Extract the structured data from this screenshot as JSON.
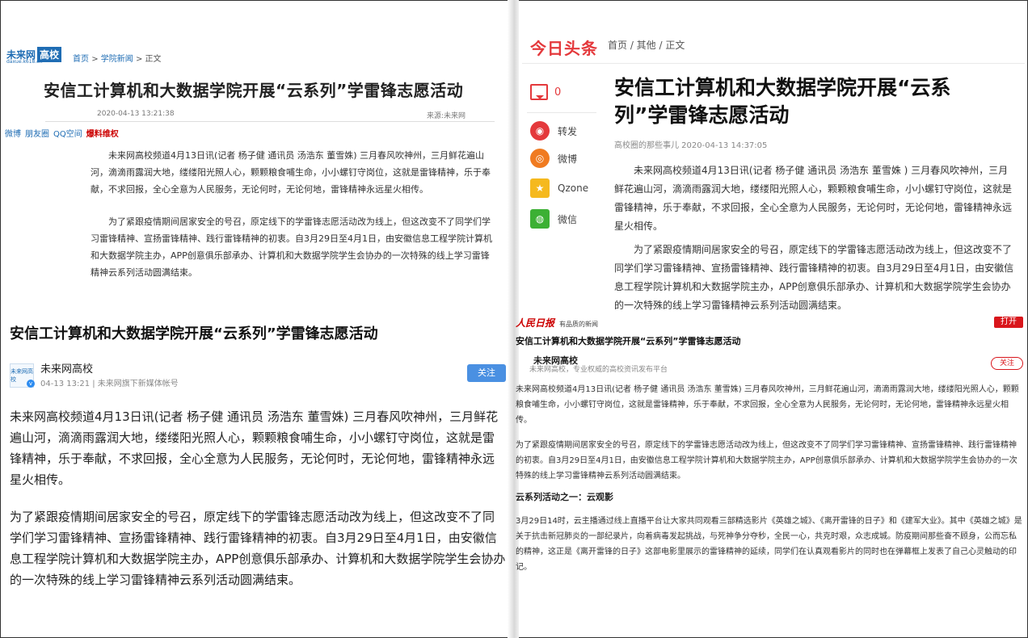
{
  "weilai": {
    "logo": "未来网",
    "logo_badge": "高校",
    "logo_sub": "daxue.k618.cn",
    "breadcrumb": [
      "首页",
      "学院新闻",
      "正文"
    ],
    "title": "安信工计算机和大数据学院开展“云系列”学雷锋志愿活动",
    "time": "2020-04-13 13:21:38",
    "source": "来源:未来网",
    "share": [
      "微博",
      "朋友圈",
      "QQ空间"
    ],
    "report": "爆料维权",
    "paragraphs": [
      "未来网高校频道4月13日讯(记者 杨子健 通讯员 汤浩东 董雪姝) 三月春风吹神州，三月鲜花遍山河，滴滴雨露润大地，缕缕阳光照人心，颗颗粮食哺生命，小小螺钉守岗位，这就是雷锋精神，乐于奉献，不求回报，全心全意为人民服务，无论何时，无论何地，雷锋精神永远星火相传。",
      "为了紧跟疫情期间居家安全的号召，原定线下的学雷锋志愿活动改为线上，但这改变不了同学们学习雷锋精神、宣扬雷锋精神、践行雷锋精神的初衷。自3月29日至4月1日，由安徽信息工程学院计算机和大数据学院主办，APP创意俱乐部承办、计算机和大数据学院学生会协办的一次特殊的线上学习雷锋精神云系列活动圆满结束。"
    ]
  },
  "mobile": {
    "title": "安信工计算机和大数据学院开展“云系列”学雷锋志愿活动",
    "author": "未来网高校",
    "avatar": "未来网高校",
    "meta": "04-13 13:21 | 未来网旗下新媒体帐号",
    "follow": "关注",
    "paragraphs": [
      "未来网高校频道4月13日讯(记者 杨子健 通讯员 汤浩东 董雪姝) 三月春风吹神州，三月鲜花遍山河，滴滴雨露润大地，缕缕阳光照人心，颗颗粮食哺生命，小小螺钉守岗位，这就是雷锋精神，乐于奉献，不求回报，全心全意为人民服务，无论何时，无论何地，雷锋精神永远星火相传。",
      "为了紧跟疫情期间居家安全的号召，原定线下的学雷锋志愿活动改为线上，但这改变不了同学们学习雷锋精神、宣扬雷锋精神、践行雷锋精神的初衷。自3月29日至4月1日，由安徽信息工程学院计算机和大数据学院主办，APP创意俱乐部承办、计算机和大数据学院学生会协办的一次特殊的线上学习雷锋精神云系列活动圆满结束。"
    ]
  },
  "toutiao": {
    "logo": "今日头条",
    "breadcrumb": "首页 / 其他 / 正文",
    "comment_count": "0",
    "share": [
      {
        "label": "转发",
        "icon": "repost-icon",
        "color": "#e4393c"
      },
      {
        "label": "微博",
        "icon": "weibo-icon",
        "color": "#f07b21"
      },
      {
        "label": "Qzone",
        "icon": "qzone-icon",
        "color": "#f5b91e"
      },
      {
        "label": "微信",
        "icon": "wechat-icon",
        "color": "#3cb034"
      }
    ],
    "title": "安信工计算机和大数据学院开展“云系列”学雷锋志愿活动",
    "meta": "高校圈的那些事儿  2020-04-13 14:37:05",
    "paragraphs": [
      "未来网高校频道4月13日讯(记者 杨子健 通讯员 汤浩东 董雪姝 ) 三月春风吹神州，三月鲜花遍山河，滴滴雨露润大地，缕缕阳光照人心，颗颗粮食哺生命，小小螺钉守岗位，这就是雷锋精神，乐于奉献，不求回报，全心全意为人民服务，无论何时，无论何地，雷锋精神永远星火相传。",
      "为了紧跟疫情期间居家安全的号召，原定线下的学雷锋志愿活动改为线上，但这改变不了同学们学习雷锋精神、宣扬雷锋精神、践行雷锋精神的初衷。自3月29日至4月1日，由安徽信息工程学院计算机和大数据学院主办，APP创意俱乐部承办、计算机和大数据学院学生会协办的一次特殊的线上学习雷锋精神云系列活动圆满结束。"
    ]
  },
  "peoples": {
    "logo": "人民日报",
    "logo_tag": "有品质的新闻",
    "open": "打开",
    "title": "安信工计算机和大数据学院开展“云系列”学雷锋志愿活动",
    "name": "未来网高校",
    "desc": "未来网高校，专业权威的高校资讯发布平台",
    "follow": "关注",
    "paragraphs": [
      "未来网高校频道4月13日讯(记者 杨子健 通讯员 汤浩东 董雪姝) 三月春风吹神州，三月鲜花遍山河，滴滴雨露润大地，缕缕阳光照人心，颗颗粮食哺生命，小小螺钉守岗位，这就是雷锋精神，乐于奉献，不求回报，全心全意为人民服务，无论何时，无论何地，雷锋精神永远星火相传。",
      "为了紧跟疫情期间居家安全的号召，原定线下的学雷锋志愿活动改为线上，但这改变不了同学们学习雷锋精神、宣扬雷锋精神、践行雷锋精神的初衷。自3月29日至4月1日，由安徽信息工程学院计算机和大数据学院主办，APP创意俱乐部承办、计算机和大数据学院学生会协办的一次特殊的线上学习雷锋精神云系列活动圆满结束。"
    ],
    "subtitle": "云系列活动之一：云观影",
    "paragraph3": "3月29日14时，云主播通过线上直播平台让大家共同观看三部精选影片《英雄之城》、《离开雷锋的日子》和《建军大业》。其中《英雄之城》是关于抗击新冠肺炎的一部纪录片，向着病毒发起挑战，与死神争分夺秒，全民一心，共克时艰，众志成城。防疫期间那些奋不顾身，公而忘私的精神，这正是《离开雷锋的日子》这部电影里展示的雷锋精神的延续，同学们在认真观看影片的同时也在弹幕框上发表了自己心灵触动的印记。"
  }
}
